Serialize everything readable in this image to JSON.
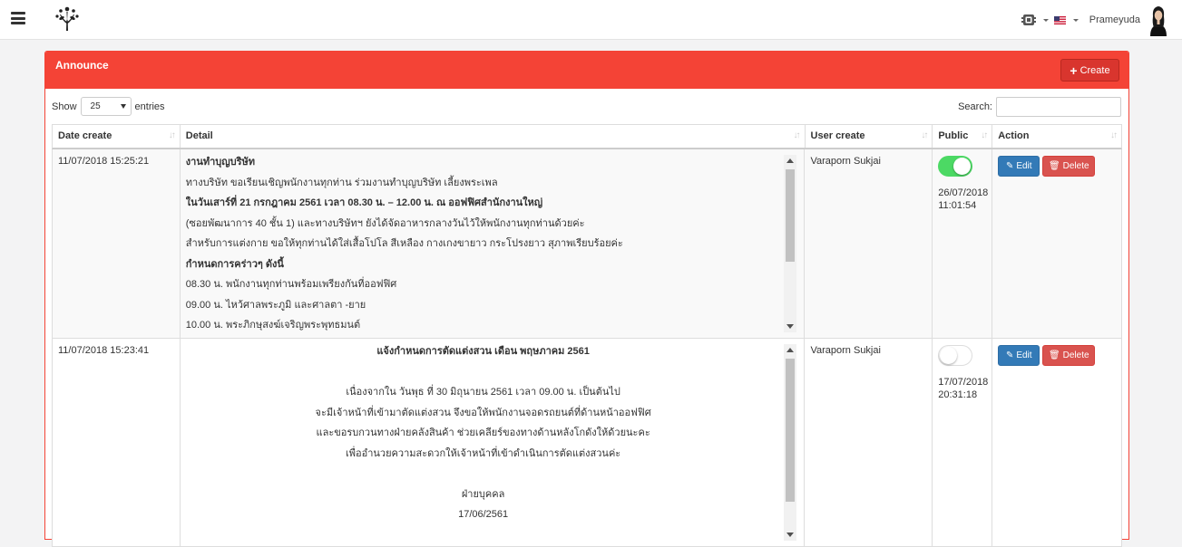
{
  "navbar": {
    "username": "Prameyuda",
    "icons": [
      "menu-icon",
      "tree-logo",
      "settings-icon",
      "us-flag-icon",
      "user-avatar"
    ]
  },
  "panel": {
    "title": "Announce",
    "create_label": "Create"
  },
  "controls": {
    "show_label": "Show",
    "length_value": "25",
    "entries_label": "entries",
    "search_label": "Search:",
    "search_value": ""
  },
  "table": {
    "headers": [
      "Date create",
      "Detail",
      "User create",
      "Public",
      "Action"
    ],
    "rows": [
      {
        "date": "11/07/2018 15:25:21",
        "detail": [
          "งานทำบุญบริษัท",
          "ทางบริษัท ขอเรียนเชิญพนักงานทุกท่าน ร่วมงานทำบุญบริษัท เลี้ยงพระเพล",
          "ในวันเสาร์ที่ 21 กรกฎาคม 2561 เวลา 08.30 น. – 12.00 น. ณ ออฟฟิศสำนักงานใหญ่",
          "(ซอยพัฒนาการ 40 ชั้น 1) และทางบริษัทฯ ยังได้จัดอาหารกลางวันไว้ให้พนักงานทุกท่านด้วยค่ะ",
          "สำหรับการแต่งกาย ขอให้ทุกท่านได้ใส่เสื้อโปโล สีเหลือง กางเกงขายาว กระโปรงยาว สุภาพเรียบร้อยค่ะ",
          "กำหนดการคร่าวๆ ดังนี้",
          "08.30 น. พนักงานทุกท่านพร้อมเพรียงกันที่ออฟฟิศ",
          "09.00 น. ไหว้ศาลพระภูมิ และศาลตา -ยาย",
          "10.00 น. พระภิกษุสงฆ์เจริญพระพุทธมนต์"
        ],
        "user": "Varaporn Sukjai",
        "public": true,
        "public_date": "26/07/2018",
        "public_time": "11:01:54",
        "edit_label": "Edit",
        "delete_label": "Delete"
      },
      {
        "date": "11/07/2018 15:23:41",
        "detail": [
          "แจ้งกำหนดการตัดแต่งสวน เดือน พฤษภาคม 2561",
          "",
          "เนื่องจากใน วันพุธ ที่ 30 มิถุนายน 2561 เวลา 09.00 น. เป็นต้นไป",
          "จะมีเจ้าหน้าที่เข้ามาตัดแต่งสวน จึงขอให้พนักงานจอดรถยนต์ที่ด้านหน้าออฟฟิศ",
          "และขอรบกวนทางฝ่ายคลังสินค้า ช่วยเคลียร์ของทางด้านหลังโกดังให้ด้วยนะคะ",
          "เพื่ออำนวยความสะดวกให้เจ้าหน้าที่เข้าดำเนินการตัดแต่งสวนค่ะ",
          "",
          "ฝ่ายบุคคล",
          "17/06/2561"
        ],
        "user": "Varaporn Sukjai",
        "public": false,
        "public_date": "17/07/2018",
        "public_time": "20:31:18",
        "edit_label": "Edit",
        "delete_label": "Delete"
      }
    ]
  },
  "colors": {
    "panel_red": "#f44336",
    "edit_blue": "#337ab7",
    "delete_red": "#d9534f",
    "toggle_green": "#4cd964"
  }
}
